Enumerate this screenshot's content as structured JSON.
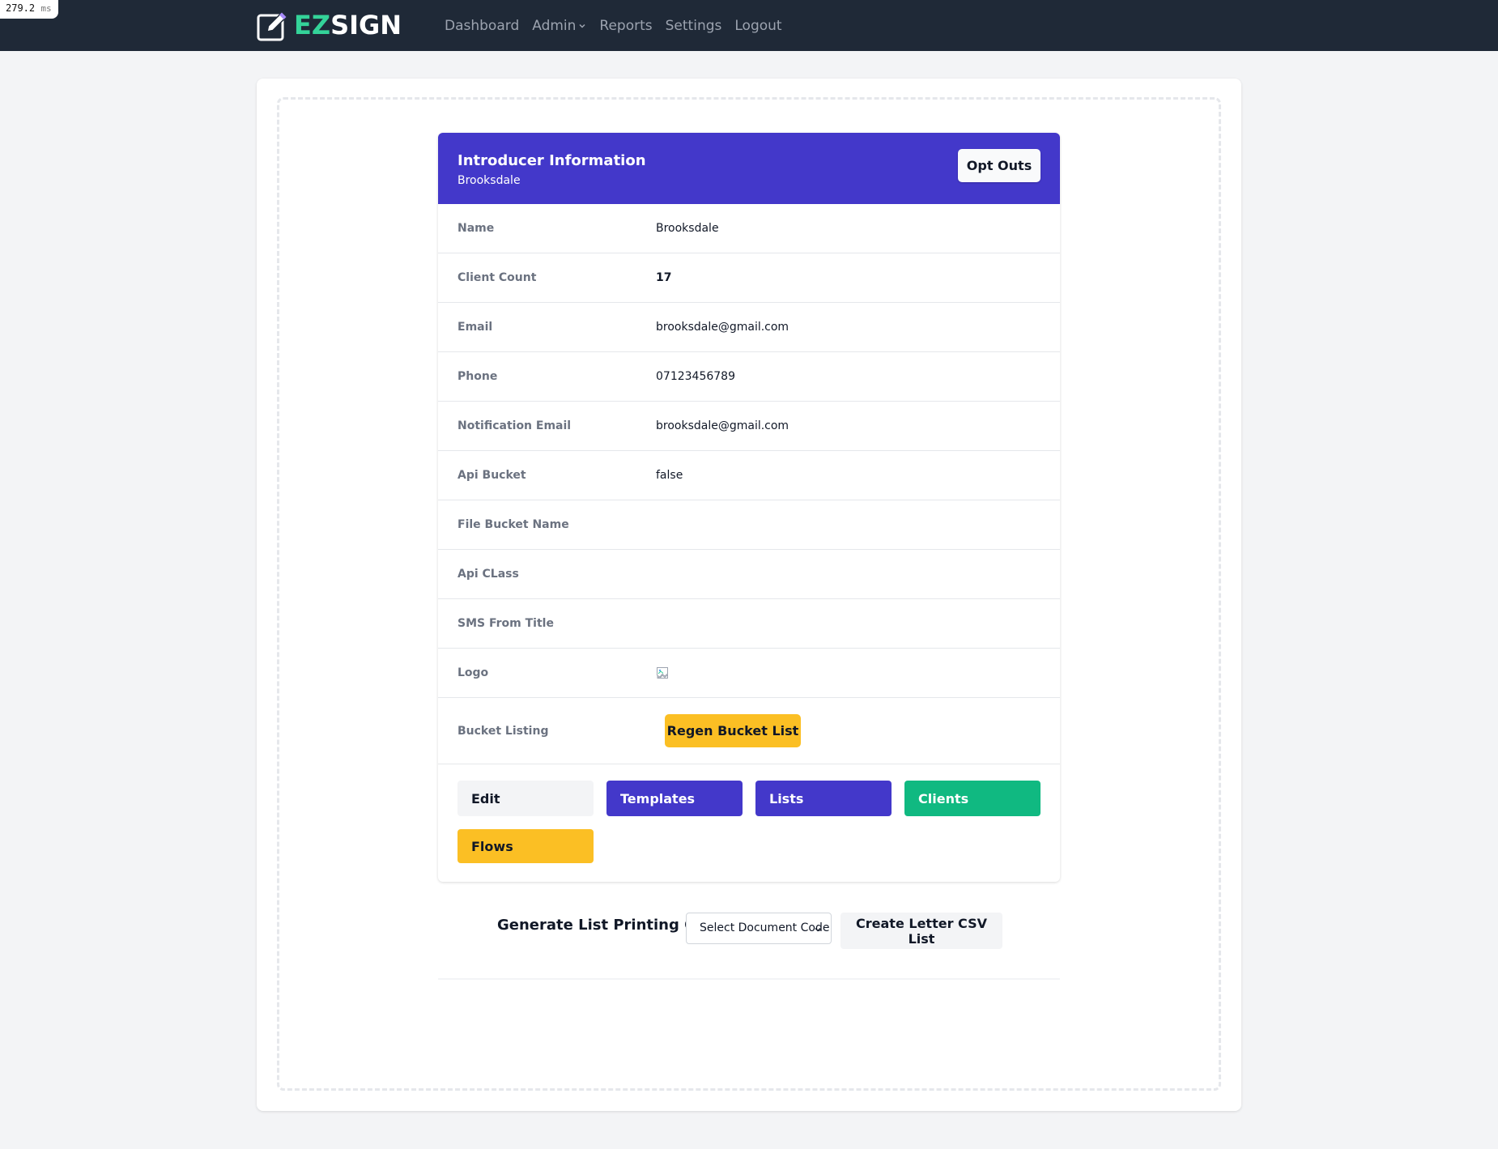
{
  "timing": {
    "value": "279.2",
    "unit": "ms"
  },
  "brand": {
    "ez": "EZ",
    "sign": "SIGN",
    "icon": "pencil-square-icon"
  },
  "nav": {
    "dashboard": "Dashboard",
    "admin": "Admin",
    "reports": "Reports",
    "settings": "Settings",
    "logout": "Logout"
  },
  "header": {
    "title": "Introducer Information",
    "subtitle": "Brooksdale",
    "opt_outs": "Opt Outs"
  },
  "rows": [
    {
      "label": "Name",
      "value": "Brooksdale"
    },
    {
      "label": "Client Count",
      "value": "17"
    },
    {
      "label": "Email",
      "value": "brooksdale@gmail.com"
    },
    {
      "label": "Phone",
      "value": "07123456789"
    },
    {
      "label": "Notification Email",
      "value": "brooksdale@gmail.com"
    },
    {
      "label": "Api Bucket",
      "value": "false"
    },
    {
      "label": "File Bucket Name",
      "value": ""
    },
    {
      "label": "Api CLass",
      "value": ""
    },
    {
      "label": "SMS From Title",
      "value": ""
    },
    {
      "label": "Logo",
      "value": ""
    },
    {
      "label": "Bucket Listing",
      "value": ""
    }
  ],
  "regen_button": "Regen Bucket List",
  "actions": {
    "edit": "Edit",
    "templates": "Templates",
    "lists": "Lists",
    "clients": "Clients",
    "flows": "Flows"
  },
  "csv": {
    "label": "Generate List Printing CSV",
    "select_value": "Select Document Code",
    "button": "Create Letter CSV List"
  },
  "colors": {
    "navbar": "#1f2937",
    "brand_accent": "#34d399",
    "header": "#4338ca",
    "indigo_button": "#4338ca",
    "green_button": "#10b981",
    "yellow_button": "#fbbf24"
  }
}
